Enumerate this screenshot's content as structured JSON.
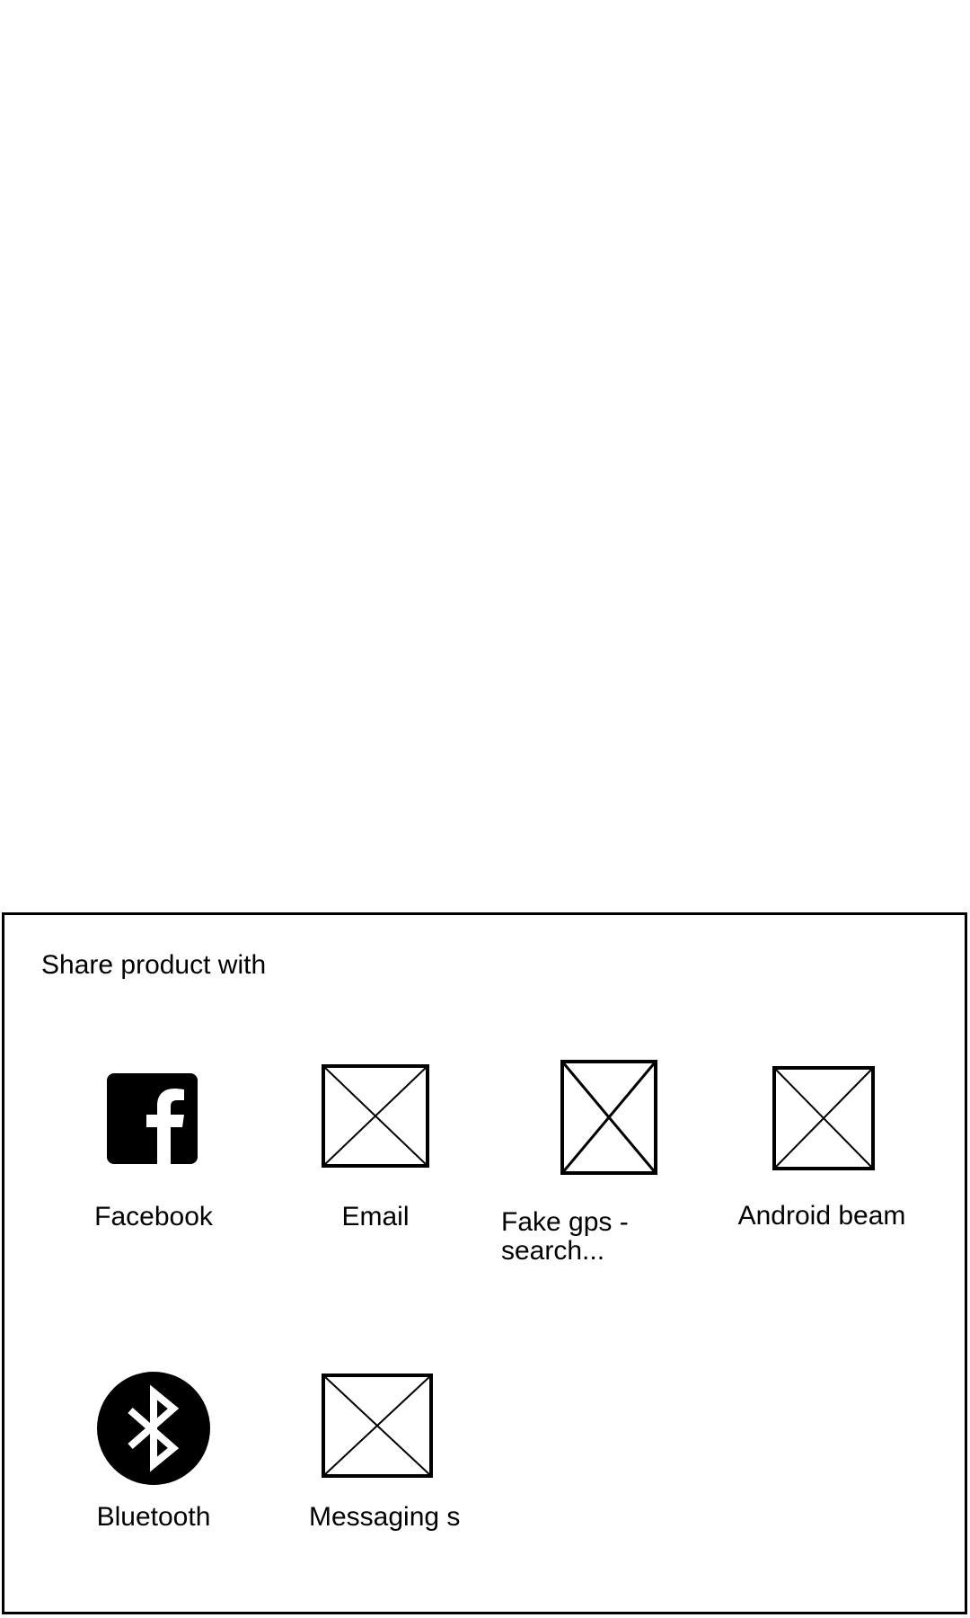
{
  "sheet": {
    "title": "Share product with"
  },
  "apps": [
    {
      "label": "Facebook",
      "icon": "facebook-icon"
    },
    {
      "label": "Email",
      "icon": "image-placeholder-icon"
    },
    {
      "label": "Fake gps - search...",
      "icon": "image-placeholder-icon"
    },
    {
      "label": "Android beam",
      "icon": "image-placeholder-icon"
    },
    {
      "label": "Bluetooth",
      "icon": "bluetooth-icon"
    },
    {
      "label": "Messaging s",
      "icon": "image-placeholder-icon"
    }
  ],
  "colors": {
    "background": "#ffffff",
    "foreground": "#000000"
  }
}
